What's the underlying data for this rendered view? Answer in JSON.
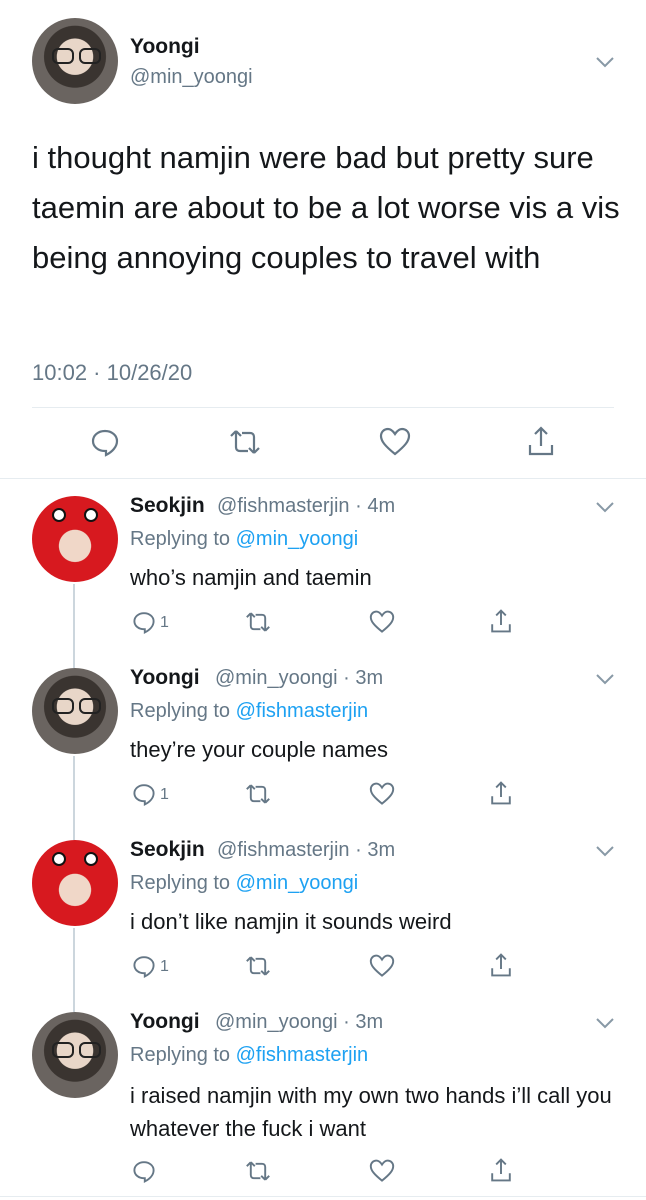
{
  "main_tweet": {
    "name": "Yoongi",
    "handle": "@min_yoongi",
    "text": "i thought namjin were bad but pretty sure taemin are about to be a lot worse vis a vis being annoying couples to travel with",
    "timestamp": "10:02 · 10/26/20"
  },
  "replies": [
    {
      "name": "Seokjin",
      "meta": "@fishmasterjin · 4m",
      "replying_prefix": "Replying to ",
      "replying_to": "@min_yoongi",
      "text": "who’s namjin and taemin",
      "reply_count": "1"
    },
    {
      "name": "Yoongi",
      "meta": "@min_yoongi · 3m",
      "replying_prefix": "Replying to ",
      "replying_to": "@fishmasterjin",
      "text": "they’re your couple names",
      "reply_count": "1"
    },
    {
      "name": "Seokjin",
      "meta": "@fishmasterjin · 3m",
      "replying_prefix": "Replying to ",
      "replying_to": "@min_yoongi",
      "text": "i don’t like namjin it sounds weird",
      "reply_count": "1"
    },
    {
      "name": "Yoongi",
      "meta": "@min_yoongi · 3m",
      "replying_prefix": "Replying to ",
      "replying_to": "@fishmasterjin",
      "text": "i raised namjin with my own two hands i’ll call you whatever the fuck i want",
      "reply_count": ""
    }
  ],
  "icons": {
    "reply": "reply-icon",
    "retweet": "retweet-icon",
    "like": "heart-icon",
    "share": "share-icon",
    "more": "chevron-down-icon"
  },
  "colors": {
    "link": "#1da1f2",
    "secondary_text": "#657786",
    "divider": "#e6ecf0",
    "thread_line": "#ccd6dd"
  }
}
